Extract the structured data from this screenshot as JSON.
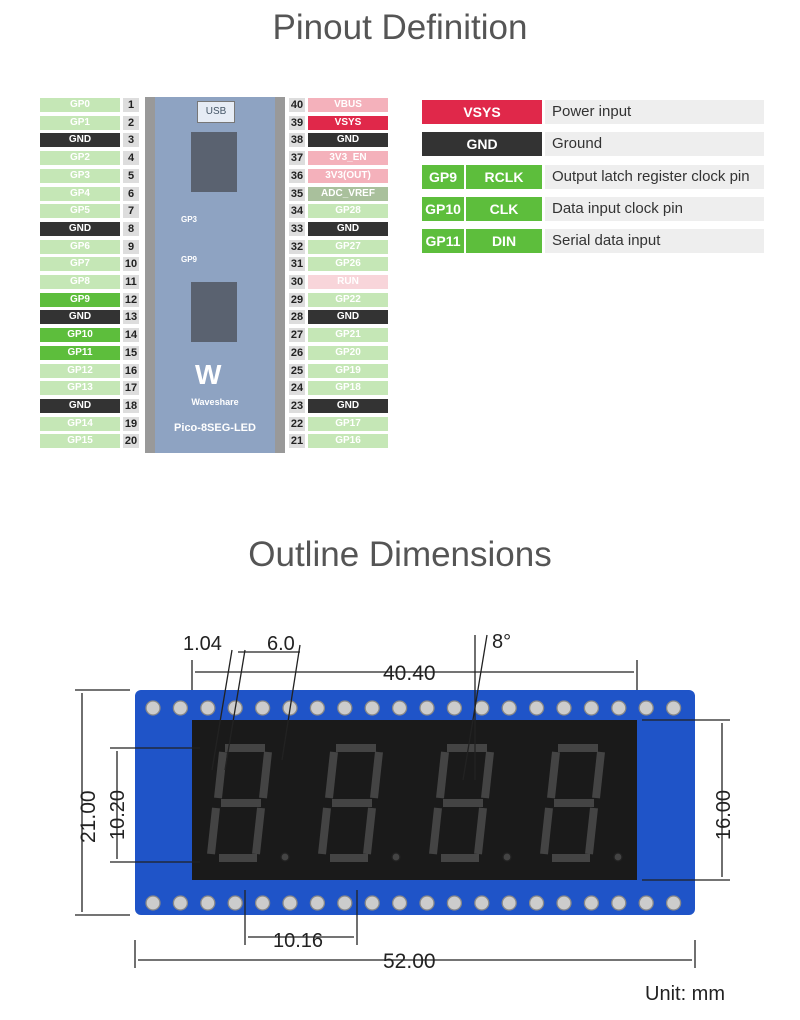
{
  "pinout_title": "Pinout Definition",
  "outline_title": "Outline Dimensions",
  "colors": {
    "gp": "#c5e7b6",
    "gnd": "#333333",
    "active": "#5dbe3c",
    "power": "#f4b1bb",
    "vsys": "#e0284a",
    "run": "#f8d5da",
    "adc": "#a9c09c"
  },
  "left_pins": [
    {
      "n": "1",
      "label": "GP0",
      "type": "gp"
    },
    {
      "n": "2",
      "label": "GP1",
      "type": "gp"
    },
    {
      "n": "3",
      "label": "GND",
      "type": "gnd"
    },
    {
      "n": "4",
      "label": "GP2",
      "type": "gp"
    },
    {
      "n": "5",
      "label": "GP3",
      "type": "gp"
    },
    {
      "n": "6",
      "label": "GP4",
      "type": "gp"
    },
    {
      "n": "7",
      "label": "GP5",
      "type": "gp"
    },
    {
      "n": "8",
      "label": "GND",
      "type": "gnd"
    },
    {
      "n": "9",
      "label": "GP6",
      "type": "gp"
    },
    {
      "n": "10",
      "label": "GP7",
      "type": "gp"
    },
    {
      "n": "11",
      "label": "GP8",
      "type": "gp"
    },
    {
      "n": "12",
      "label": "GP9",
      "type": "active"
    },
    {
      "n": "13",
      "label": "GND",
      "type": "gnd"
    },
    {
      "n": "14",
      "label": "GP10",
      "type": "active"
    },
    {
      "n": "15",
      "label": "GP11",
      "type": "active"
    },
    {
      "n": "16",
      "label": "GP12",
      "type": "gp"
    },
    {
      "n": "17",
      "label": "GP13",
      "type": "gp"
    },
    {
      "n": "18",
      "label": "GND",
      "type": "gnd"
    },
    {
      "n": "19",
      "label": "GP14",
      "type": "gp"
    },
    {
      "n": "20",
      "label": "GP15",
      "type": "gp"
    }
  ],
  "right_pins": [
    {
      "n": "40",
      "label": "VBUS",
      "type": "power"
    },
    {
      "n": "39",
      "label": "VSYS",
      "type": "vsys"
    },
    {
      "n": "38",
      "label": "GND",
      "type": "gnd"
    },
    {
      "n": "37",
      "label": "3V3_EN",
      "type": "power"
    },
    {
      "n": "36",
      "label": "3V3(OUT)",
      "type": "power"
    },
    {
      "n": "35",
      "label": "ADC_VREF",
      "type": "adc"
    },
    {
      "n": "34",
      "label": "GP28",
      "type": "gp"
    },
    {
      "n": "33",
      "label": "GND",
      "type": "gnd"
    },
    {
      "n": "32",
      "label": "GP27",
      "type": "gp"
    },
    {
      "n": "31",
      "label": "GP26",
      "type": "gp"
    },
    {
      "n": "30",
      "label": "RUN",
      "type": "run"
    },
    {
      "n": "29",
      "label": "GP22",
      "type": "gp"
    },
    {
      "n": "28",
      "label": "GND",
      "type": "gnd"
    },
    {
      "n": "27",
      "label": "GP21",
      "type": "gp"
    },
    {
      "n": "26",
      "label": "GP20",
      "type": "gp"
    },
    {
      "n": "25",
      "label": "GP19",
      "type": "gp"
    },
    {
      "n": "24",
      "label": "GP18",
      "type": "gp"
    },
    {
      "n": "23",
      "label": "GND",
      "type": "gnd"
    },
    {
      "n": "22",
      "label": "GP17",
      "type": "gp"
    },
    {
      "n": "21",
      "label": "GP16",
      "type": "gp"
    }
  ],
  "board": {
    "usb": "USB",
    "brand": "Waveshare",
    "name": "Pico-8SEG-LED",
    "jumper1": "GP3",
    "jumper2": "GP9"
  },
  "legend": [
    {
      "pins": [
        "VSYS"
      ],
      "desc": "Power input",
      "type": "vsys"
    },
    {
      "pins": [
        "GND"
      ],
      "desc": "Ground",
      "type": "gnd"
    },
    {
      "pins": [
        "GP9",
        "RCLK"
      ],
      "desc": "Output latch register clock pin",
      "type": "active"
    },
    {
      "pins": [
        "GP10",
        "CLK"
      ],
      "desc": "Data input clock pin",
      "type": "active"
    },
    {
      "pins": [
        "GP11",
        "DIN"
      ],
      "desc": "Serial data input",
      "type": "active"
    }
  ],
  "dimensions": {
    "seg_width": "1.04",
    "digit_width": "6.0",
    "angle": "8°",
    "display_width": "40.40",
    "height": "21.00",
    "display_digit_height": "10.20",
    "display_height": "16.00",
    "digit_pitch": "10.16",
    "length": "52.00"
  },
  "unit": "Unit: mm"
}
